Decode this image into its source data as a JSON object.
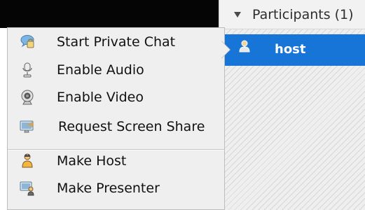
{
  "panel": {
    "title": "Participants (1)"
  },
  "participants": {
    "selected_user": "host"
  },
  "context_menu": {
    "items": [
      {
        "label": "Start Private Chat",
        "icon": "private-chat-icon"
      },
      {
        "label": "Enable Audio",
        "icon": "microphone-icon"
      },
      {
        "label": "Enable Video",
        "icon": "webcam-icon"
      },
      {
        "label": "Request Screen Share",
        "icon": "screen-share-icon"
      },
      {
        "label": "Make Host",
        "icon": "host-user-icon"
      },
      {
        "label": "Make Presenter",
        "icon": "presenter-icon"
      }
    ]
  },
  "colors": {
    "selection": "#1875d8",
    "menu_background": "#efefef",
    "top_strip": "#050505"
  }
}
